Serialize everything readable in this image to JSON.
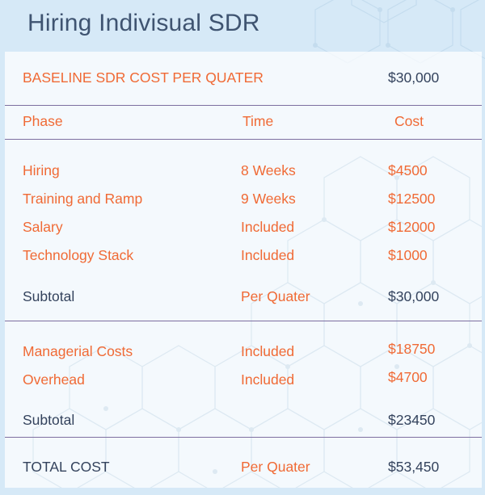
{
  "title": "Hiring Indivisual SDR",
  "baseline": {
    "label": "BASELINE SDR COST PER QUATER",
    "value": "$30,000"
  },
  "headers": {
    "phase": "Phase",
    "time": "Time",
    "cost": "Cost"
  },
  "section1": [
    {
      "phase": "Hiring",
      "time": "8 Weeks",
      "cost": "$4500"
    },
    {
      "phase": "Training and Ramp",
      "time": "9 Weeks",
      "cost": "$12500"
    },
    {
      "phase": "Salary",
      "time": "Included",
      "cost": "$12000"
    },
    {
      "phase": "Technology Stack",
      "time": "Included",
      "cost": "$1000"
    }
  ],
  "subtotal1": {
    "label": "Subtotal",
    "time": "Per Quater",
    "cost": "$30,000"
  },
  "section2": [
    {
      "phase": "Managerial Costs",
      "time": "Included",
      "cost": "$18750"
    },
    {
      "phase": "Overhead",
      "time": "Included",
      "cost": "$4700"
    }
  ],
  "subtotal2": {
    "label": "Subtotal",
    "cost": "$23450"
  },
  "total": {
    "label": "TOTAL COST",
    "time": "Per Quater",
    "cost": "$53,450"
  },
  "colors": {
    "accent": "#f06a35",
    "navy": "#34435d",
    "background": "#d6e9f7",
    "divider": "#7d6fa0"
  }
}
